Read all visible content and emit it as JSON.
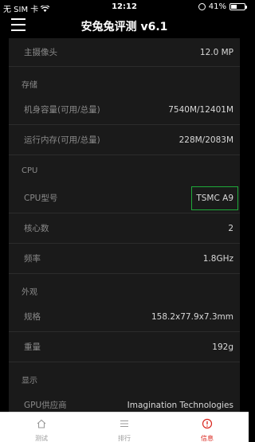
{
  "statusbar": {
    "carrier": "无 SIM 卡",
    "time": "12:12",
    "battery_pct": "41%",
    "battery_level": 0.41
  },
  "header": {
    "title": "安兔兔评测 v6.1"
  },
  "rows": {
    "camera": {
      "label": "主摄像头",
      "value": "12.0 MP"
    },
    "storage_section": "存储",
    "rom": {
      "label": "机身容量(可用/总量)",
      "value": "7540M/12401M"
    },
    "ram": {
      "label": "运行内存(可用/总量)",
      "value": "228M/2083M"
    },
    "cpu_section": "CPU",
    "cpu_model": {
      "label": "CPU型号",
      "value": "TSMC A9"
    },
    "cores": {
      "label": "核心数",
      "value": "2"
    },
    "freq": {
      "label": "频率",
      "value": "1.8GHz"
    },
    "appearance_section": "外观",
    "size": {
      "label": "规格",
      "value": "158.2x77.9x7.3mm"
    },
    "weight": {
      "label": "重量",
      "value": "192g"
    },
    "display_section": "显示",
    "gpu": {
      "label": "GPU供应商",
      "value": "Imagination Technologies"
    }
  },
  "tabs": [
    {
      "label": "测试",
      "icon": "home-icon"
    },
    {
      "label": "排行",
      "icon": "list-icon"
    },
    {
      "label": "信息",
      "icon": "info-icon",
      "active": true
    }
  ],
  "colors": {
    "highlight": "#1faa3a",
    "active_tab": "#d9241c"
  }
}
